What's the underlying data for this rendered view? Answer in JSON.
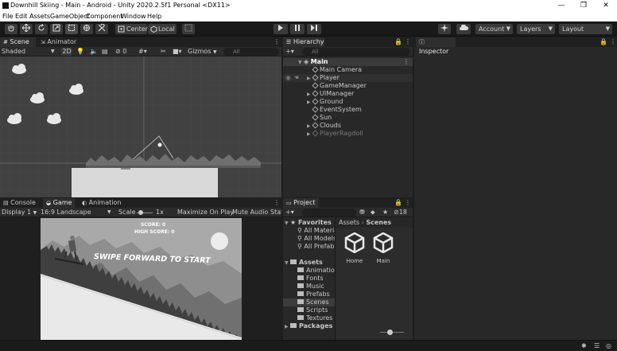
{
  "window": {
    "title": "Downhill Skiing - Main - Android - Unity 2020.2.5f1 Personal <DX11>",
    "controls": [
      "—",
      "❐",
      "✕"
    ]
  },
  "menu": [
    "File",
    "Edit",
    "Assets",
    "GameObject",
    "Component",
    "Window",
    "Help"
  ],
  "toolbar": {
    "pivot_label": "Center",
    "space_label": "Local",
    "account_label": "Account",
    "layers_label": "Layers",
    "layout_label": "Layout"
  },
  "scene": {
    "tabs": [
      "Scene",
      "Animator"
    ],
    "shading": "Shaded",
    "mode_2d": "2D",
    "hidden_count": "0",
    "gizmos": "Gizmos",
    "search_placeholder": "All"
  },
  "hierarchy": {
    "tab": "Hierarchy",
    "search_placeholder": "All",
    "scene_name": "Main",
    "items": [
      {
        "label": "Main Camera",
        "expandable": false
      },
      {
        "label": "Player",
        "expandable": true
      },
      {
        "label": "GameManager",
        "expandable": false
      },
      {
        "label": "UIManager",
        "expandable": true
      },
      {
        "label": "Ground",
        "expandable": true
      },
      {
        "label": "EventSystem",
        "expandable": false
      },
      {
        "label": "Sun",
        "expandable": false
      },
      {
        "label": "Clouds",
        "expandable": true
      },
      {
        "label": "PlayerRagdoll",
        "expandable": true
      }
    ]
  },
  "inspector": {
    "tab": "Inspector"
  },
  "game": {
    "tabs": [
      "Console",
      "Game",
      "Animation"
    ],
    "display": "Display 1",
    "aspect": "16:9 Landscape",
    "scale_label": "Scale",
    "scale_value": "1x",
    "maximize": "Maximize On Play",
    "mute": "Mute Audio",
    "stats": "Stat",
    "score": "SCORE: 0",
    "high_score": "HIGH SCORE: 0",
    "prompt": "SWIPE FORWARD TO START"
  },
  "project": {
    "tab": "Project",
    "hidden_count": "18",
    "favorites_label": "Favorites",
    "favorites": [
      "All Materia",
      "All Models",
      "All Prefabs"
    ],
    "assets_label": "Assets",
    "folders": [
      "Animation",
      "Fonts",
      "Music",
      "Prefabs",
      "Scenes",
      "Scripts",
      "Textures"
    ],
    "packages_label": "Packages",
    "breadcrumb": [
      "Assets",
      "Scenes"
    ],
    "scene_assets": [
      "Home",
      "Main"
    ]
  }
}
